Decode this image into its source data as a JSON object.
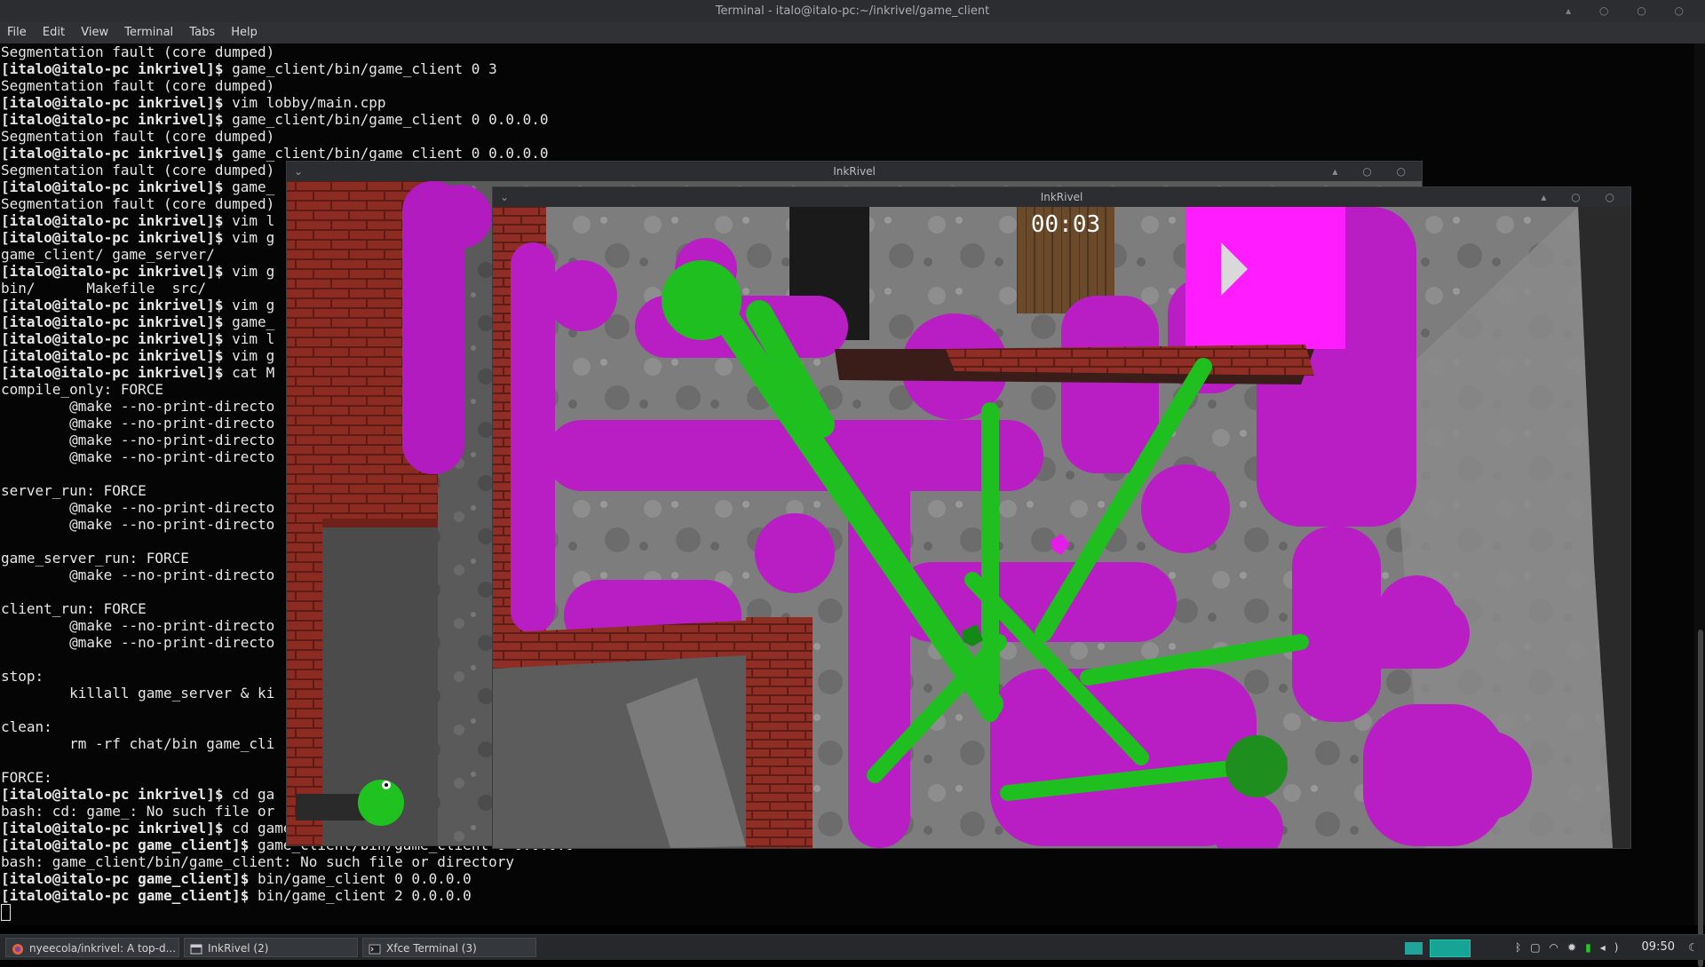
{
  "terminal": {
    "title": "Terminal - italo@italo-pc:~/inkrivel/game_client",
    "menu": [
      "File",
      "Edit",
      "View",
      "Terminal",
      "Tabs",
      "Help"
    ],
    "lines": [
      "Segmentation fault (core dumped)",
      "[italo@italo-pc inkrivel]$ game_client/bin/game_client 0 3",
      "Segmentation fault (core dumped)",
      "[italo@italo-pc inkrivel]$ vim lobby/main.cpp",
      "[italo@italo-pc inkrivel]$ game_client/bin/game_client 0 0.0.0.0",
      "Segmentation fault (core dumped)",
      "[italo@italo-pc inkrivel]$ game_client/bin/game_client 0 0.0.0.0",
      "Segmentation fault (core dumped)",
      "[italo@italo-pc inkrivel]$ game_",
      "Segmentation fault (core dumped)",
      "[italo@italo-pc inkrivel]$ vim l",
      "[italo@italo-pc inkrivel]$ vim g",
      "game_client/ game_server/",
      "[italo@italo-pc inkrivel]$ vim g",
      "bin/      Makefile  src/",
      "[italo@italo-pc inkrivel]$ vim g",
      "[italo@italo-pc inkrivel]$ game_",
      "[italo@italo-pc inkrivel]$ vim l",
      "[italo@italo-pc inkrivel]$ vim g",
      "[italo@italo-pc inkrivel]$ cat M",
      "compile_only: FORCE",
      "        @make --no-print-directo",
      "        @make --no-print-directo",
      "        @make --no-print-directo",
      "        @make --no-print-directo",
      "",
      "server_run: FORCE",
      "        @make --no-print-directo",
      "        @make --no-print-directo",
      "",
      "game_server_run: FORCE",
      "        @make --no-print-directo",
      "",
      "client_run: FORCE",
      "        @make --no-print-directo",
      "        @make --no-print-directo",
      "",
      "stop:",
      "        killall game_server & ki",
      "",
      "clean:",
      "        rm -rf chat/bin game_cli",
      "",
      "FORCE:",
      "[italo@italo-pc inkrivel]$ cd ga",
      "bash: cd: game_: No such file or",
      "[italo@italo-pc inkrivel]$ cd game_client/",
      "[italo@italo-pc game_client]$ game_client/bin/game_client 0 0.0.0.0",
      "bash: game_client/bin/game_client: No such file or directory",
      "[italo@italo-pc game_client]$ bin/game_client 0 0.0.0.0",
      "[italo@italo-pc game_client]$ bin/game_client 2 0.0.0.0"
    ]
  },
  "game_windows": [
    {
      "title": "InkRivel",
      "timer": ""
    },
    {
      "title": "InkRivel",
      "timer": "00:03"
    }
  ],
  "taskbar": {
    "tasks": [
      {
        "label": "nyeecola/inkrivel: A top-d...",
        "icon": "firefox-icon"
      },
      {
        "label": "InkRivel (2)",
        "icon": "window-icon"
      },
      {
        "label": "Xfce Terminal (3)",
        "icon": "terminal-icon"
      }
    ],
    "clock": "09:50"
  },
  "colors": {
    "ink_magenta": "#c81ccf",
    "ink_green": "#1fbf1f",
    "brick": "#8a2a22"
  }
}
